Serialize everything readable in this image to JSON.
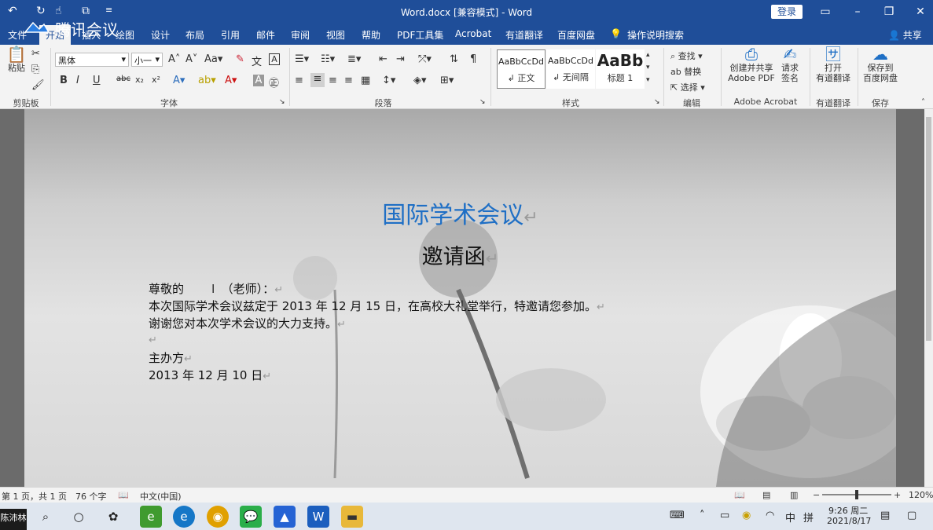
{
  "app": {
    "window_title": "Word.docx [兼容模式]  -  Word",
    "login_label": "登录",
    "share_label": "共享",
    "meeting_overlay": "腾讯会议"
  },
  "tabs": [
    "文件",
    "开始",
    "插入",
    "绘图",
    "设计",
    "布局",
    "引用",
    "邮件",
    "审阅",
    "视图",
    "帮助",
    "PDF工具集",
    "Acrobat",
    "有道翻译",
    "百度网盘"
  ],
  "tell_me": "操作说明搜索",
  "ribbon": {
    "clipboard": {
      "paste": "粘贴",
      "group": "剪贴板"
    },
    "font": {
      "font_name": "黑体",
      "font_size": "小一",
      "group": "字体",
      "buttons": [
        "B",
        "I",
        "U",
        "abc",
        "x₂",
        "x²"
      ]
    },
    "paragraph": {
      "group": "段落"
    },
    "styles": {
      "group": "样式",
      "items": [
        {
          "sample": "AaBbCcDd",
          "name": "↲ 正文"
        },
        {
          "sample": "AaBbCcDd",
          "name": "↲ 无间隔"
        },
        {
          "sample": "AaBb",
          "name": "标题 1"
        }
      ]
    },
    "editing": {
      "group": "编辑",
      "find": "查找",
      "replace": "替换",
      "select": "选择"
    },
    "acrobat": {
      "create": "创建并共享",
      "create2": "Adobe PDF",
      "sign": "请求",
      "sign2": "签名",
      "group": "Adobe Acrobat"
    },
    "youdao": {
      "open": "打开",
      "open2": "有道翻译",
      "group": "有道翻译"
    },
    "baidu": {
      "save": "保存到",
      "save2": "百度网盘",
      "group": "保存"
    }
  },
  "document": {
    "title": "国际学术会议",
    "subtitle": "邀请函",
    "salutation": "尊敬的          （老师）：",
    "body1": "本次国际学术会议兹定于 2013 年 12 月 15 日，在高校大礼堂举行，特邀请您参加。",
    "body2": "谢谢您对本次学术会议的大力支持。",
    "organizer": "主办方",
    "date": "2013 年 12 月 10 日",
    "para_mark": "↵",
    "title_color": "#1f6fc5"
  },
  "status": {
    "page": "第 1 页，共 1 页",
    "words": "76 个字",
    "language": "中文(中国)",
    "zoom": "120%"
  },
  "taskbar": {
    "user": "陈沛林",
    "time": "9:26 周二",
    "date": "2021/8/17",
    "ime1": "中",
    "ime2": "拼"
  }
}
